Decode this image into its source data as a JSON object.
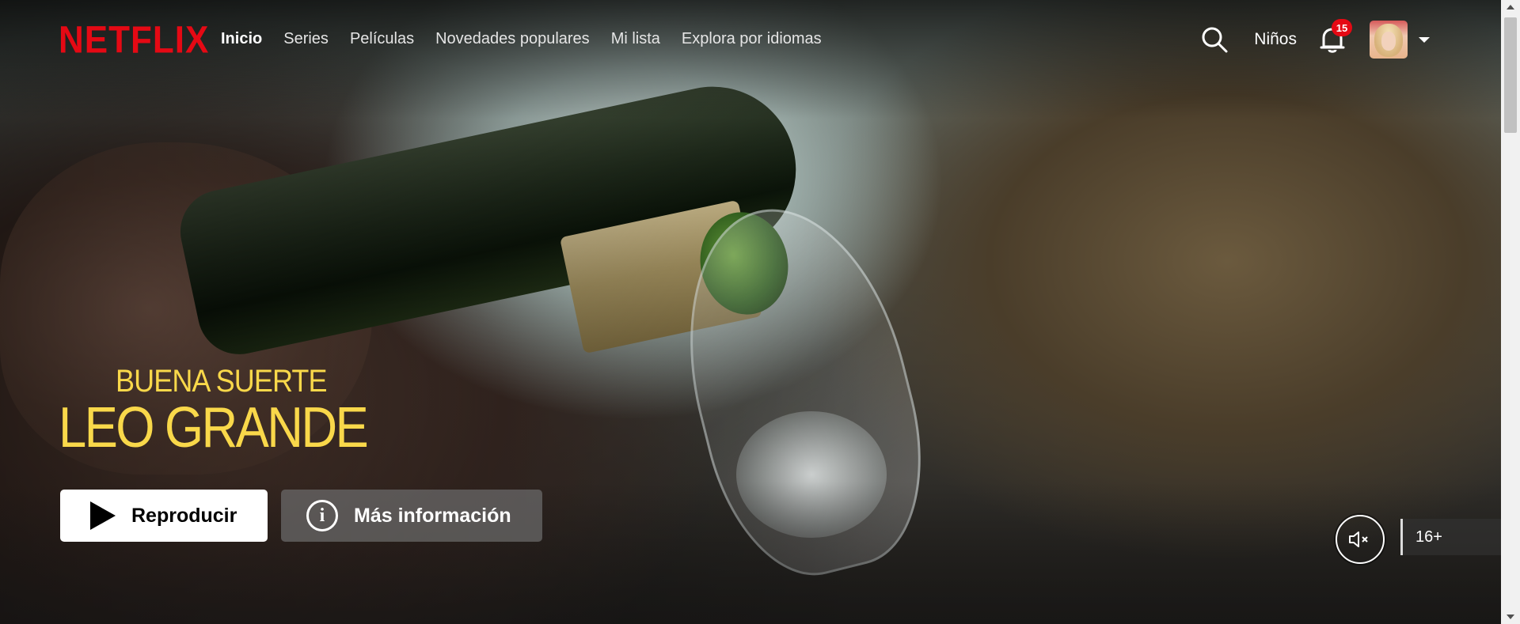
{
  "header": {
    "logo": "NETFLIX",
    "nav": [
      "Inicio",
      "Series",
      "Películas",
      "Novedades populares",
      "Mi lista",
      "Explora por idiomas"
    ],
    "active_nav": "Inicio",
    "kids_label": "Niños",
    "notification_count": "15"
  },
  "hero": {
    "title_line1": "BUENA SUERTE",
    "title_line2": "LEO GRANDE",
    "play_label": "Reproducir",
    "info_label": "Más información",
    "info_glyph": "i",
    "maturity_rating": "16+"
  },
  "icons": {
    "search": "search-icon",
    "bell": "bell-icon",
    "mute": "volume-mute-icon",
    "play": "play-icon",
    "info": "info-icon",
    "caret": "caret-down-icon"
  },
  "colors": {
    "brand_red": "#e50914",
    "title_yellow": "#f9d84a",
    "background": "#141414"
  }
}
